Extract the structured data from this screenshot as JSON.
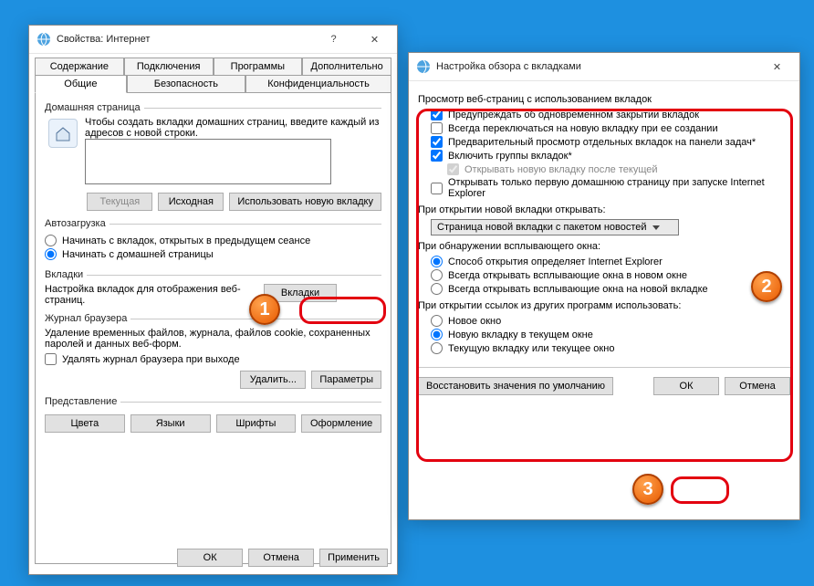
{
  "win1": {
    "title": "Свойства: Интернет",
    "tabsRow1": [
      "Содержание",
      "Подключения",
      "Программы",
      "Дополнительно"
    ],
    "tabsRow2": [
      "Общие",
      "Безопасность",
      "Конфиденциальность"
    ],
    "activeTab": "Общие",
    "home": {
      "legend": "Домашняя страница",
      "desc": "Чтобы создать вкладки домашних страниц, введите каждый из адресов с новой строки.",
      "value": "",
      "btnCurrent": "Текущая",
      "btnDefault": "Исходная",
      "btnNewTab": "Использовать новую вкладку"
    },
    "startup": {
      "legend": "Автозагрузка",
      "optPrev": "Начинать с вкладок, открытых в предыдущем сеансе",
      "optHome": "Начинать с домашней страницы"
    },
    "tabs": {
      "legend": "Вкладки",
      "desc": "Настройка вкладок для отображения веб-страниц.",
      "btn": "Вкладки"
    },
    "history": {
      "legend": "Журнал браузера",
      "desc": "Удаление временных файлов, журнала, файлов cookie, сохраненных паролей и данных веб-форм.",
      "check": "Удалять журнал браузера при выходе",
      "btnDelete": "Удалить...",
      "btnSettings": "Параметры"
    },
    "appearance": {
      "legend": "Представление",
      "btnColors": "Цвета",
      "btnLang": "Языки",
      "btnFonts": "Шрифты",
      "btnAccess": "Оформление"
    },
    "footer": {
      "ok": "ОК",
      "cancel": "Отмена",
      "apply": "Применить"
    }
  },
  "win2": {
    "title": "Настройка обзора с вкладками",
    "sect1": {
      "title": "Просмотр веб-страниц с использованием вкладок",
      "c1": "Предупреждать об одновременном закрытии вкладок",
      "c2": "Всегда переключаться на новую вкладку при ее создании",
      "c3": "Предварительный просмотр отдельных вкладок на панели задач*",
      "c4": "Включить группы вкладок*",
      "c4a": "Открывать новую вкладку после текущей",
      "c5": "Открывать только первую домашнюю страницу при запуске Internet Explorer"
    },
    "sect2": {
      "title": "При открытии новой вкладки открывать:",
      "value": "Страница новой вкладки с пакетом новостей"
    },
    "sect3": {
      "title": "При обнаружении всплывающего окна:",
      "r1": "Способ открытия определяет Internet Explorer",
      "r2": "Всегда открывать всплывающие окна в новом окне",
      "r3": "Всегда открывать всплывающие окна на новой вкладке"
    },
    "sect4": {
      "title": "При открытии ссылок из других программ использовать:",
      "r1": "Новое окно",
      "r2": "Новую вкладку в текущем окне",
      "r3": "Текущую вкладку или текущее окно"
    },
    "footer": {
      "restore": "Восстановить значения по умолчанию",
      "ok": "ОК",
      "cancel": "Отмена"
    }
  },
  "markers": {
    "m1": "1",
    "m2": "2",
    "m3": "3"
  }
}
